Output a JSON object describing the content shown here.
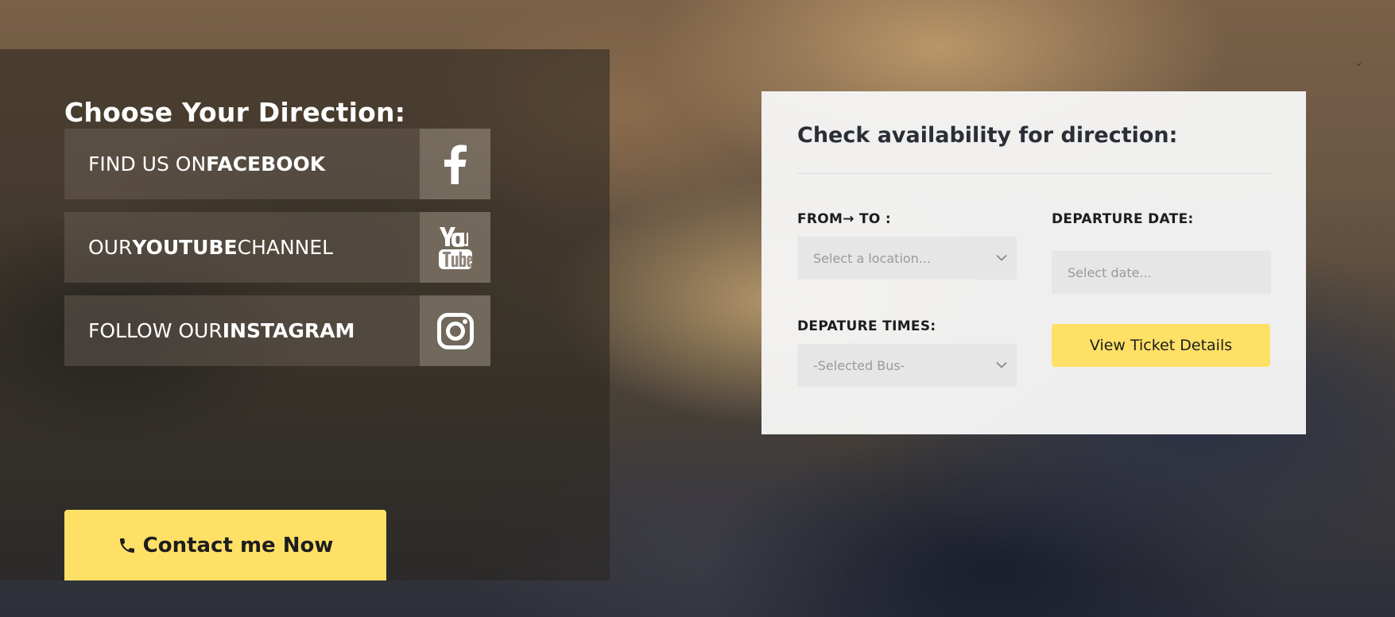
{
  "left": {
    "title": "Choose Your Direction:",
    "social": [
      {
        "prefix": "FIND US ON ",
        "strong": "FACEBOOK",
        "suffix": "",
        "icon": "facebook-icon"
      },
      {
        "prefix": "OUR ",
        "strong": "YOUTUBE",
        "suffix": " CHANNEL",
        "icon": "youtube-icon"
      },
      {
        "prefix": "FOLLOW OUR ",
        "strong": "INSTAGRAM",
        "suffix": "",
        "icon": "instagram-icon"
      }
    ],
    "contact_label": "Contact me Now",
    "contact_icon": "phone-icon"
  },
  "availability": {
    "title": "Check availability for direction:",
    "from_to_label": "FROM→ TO :",
    "location_placeholder": "Select a location...",
    "departure_date_label": "DEPARTURE DATE:",
    "date_placeholder": "Select date...",
    "departure_times_label": "DEPATURE TIMES:",
    "bus_placeholder": "-Selected Bus-",
    "ticket_button": "View Ticket Details"
  },
  "colors": {
    "accent": "#ffe066",
    "card": "#f5f5f5",
    "field": "#e6e6e6",
    "text_dark": "#1d1d1d"
  }
}
